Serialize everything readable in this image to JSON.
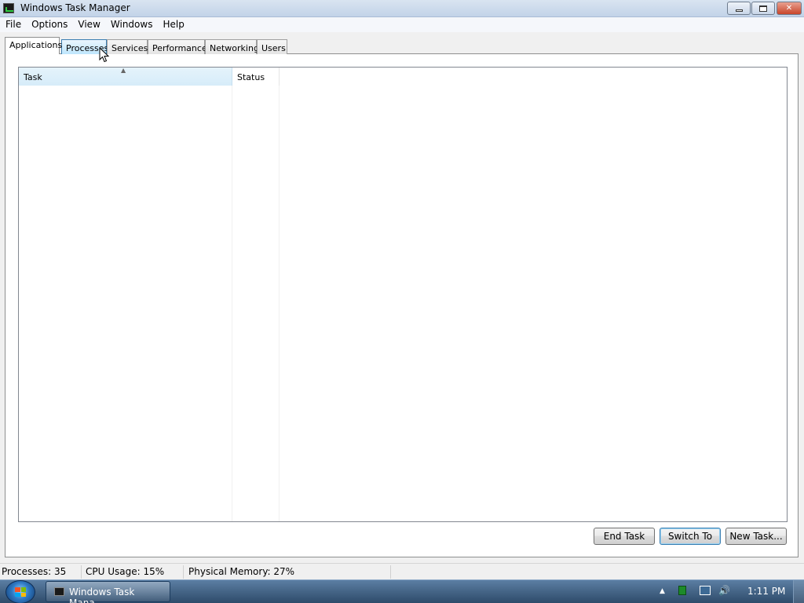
{
  "window": {
    "title": "Windows Task Manager"
  },
  "menu": {
    "items": [
      "File",
      "Options",
      "View",
      "Windows",
      "Help"
    ]
  },
  "tabs": [
    {
      "label": "Applications",
      "active": true
    },
    {
      "label": "Processes",
      "active": false
    },
    {
      "label": "Services",
      "active": false
    },
    {
      "label": "Performance",
      "active": false
    },
    {
      "label": "Networking",
      "active": false
    },
    {
      "label": "Users",
      "active": false
    }
  ],
  "list": {
    "columns": [
      "Task",
      "Status"
    ],
    "sort_column": "Task",
    "rows": []
  },
  "buttons": {
    "end_task": "End Task",
    "switch_to": "Switch To",
    "new_task": "New Task..."
  },
  "status": {
    "processes": "Processes: 35",
    "cpu": "CPU Usage: 15%",
    "memory": "Physical Memory: 27%"
  },
  "taskbar": {
    "task_label": "Windows Task Mana...",
    "clock": "1:11 PM"
  }
}
